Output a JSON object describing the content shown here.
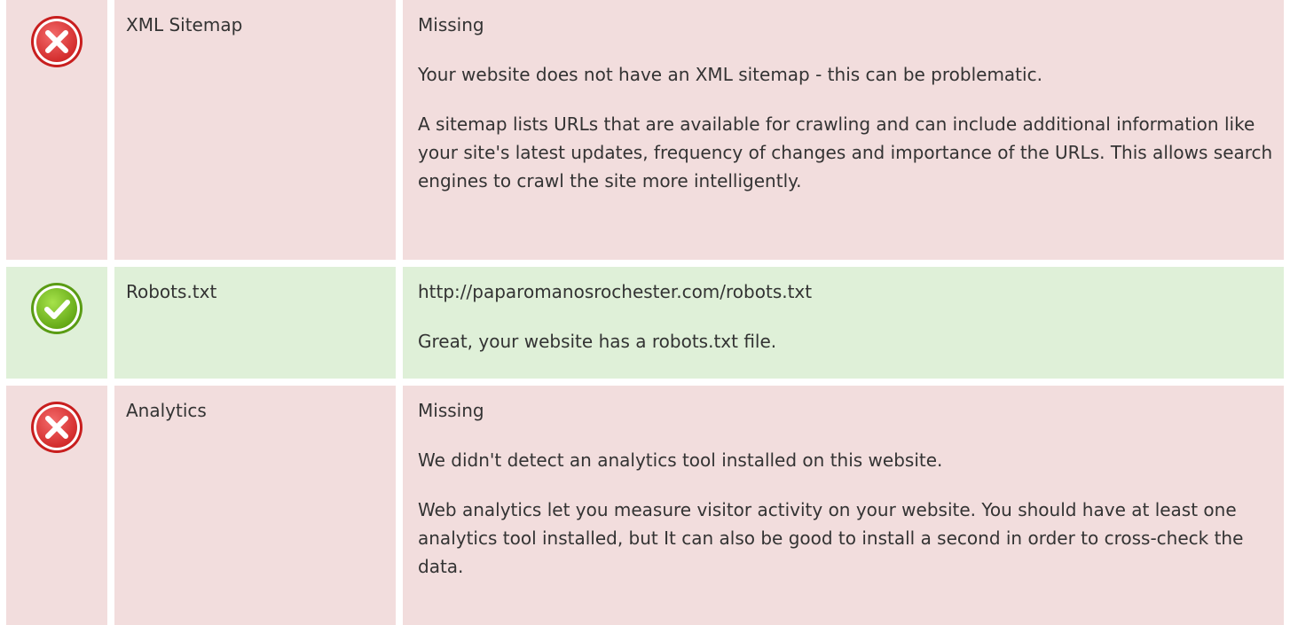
{
  "rows": [
    {
      "status": "fail",
      "icon": "error-x-icon",
      "label": "XML Sitemap",
      "value": "Missing",
      "paragraphs": [
        "Your website does not have an XML sitemap - this can be problematic.",
        "A sitemap lists URLs that are available for crawling and can include additional information like your site's latest updates, frequency of changes and importance of the URLs. This allows search engines to crawl the site more intelligently."
      ]
    },
    {
      "status": "pass",
      "icon": "success-check-icon",
      "label": "Robots.txt",
      "value": "http://paparomanosrochester.com/robots.txt",
      "paragraphs": [
        "Great, your website has a robots.txt file."
      ]
    },
    {
      "status": "fail",
      "icon": "error-x-icon",
      "label": "Analytics",
      "value": "Missing",
      "paragraphs": [
        "We didn't detect an analytics tool installed on this website.",
        "Web analytics let you measure visitor activity on your website. You should have at least one analytics tool installed, but It can also be good to install a second in order to cross-check the data."
      ]
    }
  ],
  "colors": {
    "fail_bg": "#f2dddd",
    "pass_bg": "#dff0d8",
    "error_red": "#e03b3b",
    "success_green": "#7cc520"
  }
}
